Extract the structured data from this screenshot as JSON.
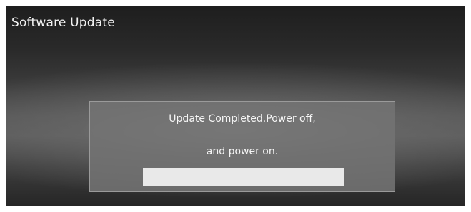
{
  "window": {
    "title": "Software Update"
  },
  "dialog": {
    "message_line1": "Update Completed.Power off,",
    "message_line2": "and power on.",
    "progress_fraction": 1.0
  },
  "colors": {
    "title_text": "#f2f2f2",
    "dialog_border": "#9a9a9a",
    "progress_fill": "#e9e9e9"
  }
}
